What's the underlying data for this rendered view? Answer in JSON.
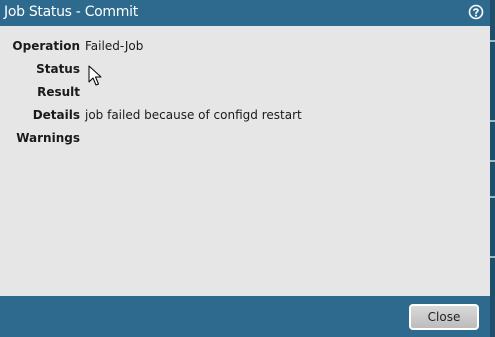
{
  "dialog": {
    "title": "Job Status - Commit",
    "help_icon": "help-circle-icon"
  },
  "fields": [
    {
      "label": "Operation",
      "value": "Failed-Job"
    },
    {
      "label": "Status",
      "value": ""
    },
    {
      "label": "Result",
      "value": ""
    },
    {
      "label": "Details",
      "value": "job failed because of configd restart"
    },
    {
      "label": "Warnings",
      "value": ""
    }
  ],
  "footer": {
    "close_label": "Close"
  },
  "colors": {
    "titlebar": "#2d6a8d",
    "content_bg": "#e6e6e6"
  }
}
